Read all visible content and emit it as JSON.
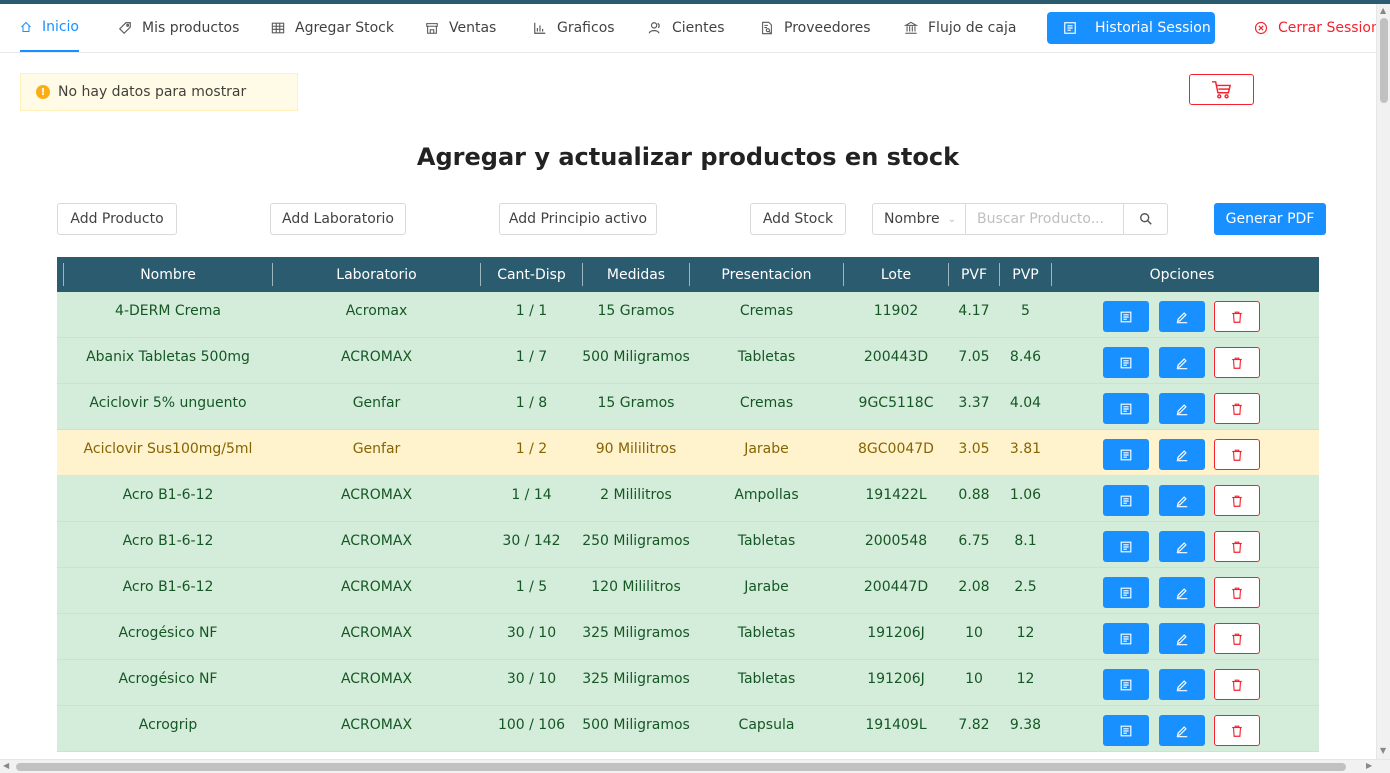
{
  "nav": {
    "items": [
      {
        "label": "Inicio",
        "icon": "home-icon",
        "active": true
      },
      {
        "label": "Mis productos",
        "icon": "tag-icon"
      },
      {
        "label": "Agregar Stock",
        "icon": "table-icon"
      },
      {
        "label": "Ventas",
        "icon": "shop-icon"
      },
      {
        "label": "Graficos",
        "icon": "bar-chart-icon"
      },
      {
        "label": "Cientes",
        "icon": "team-icon"
      },
      {
        "label": "Proveedores",
        "icon": "file-search-icon"
      },
      {
        "label": "Flujo de caja",
        "icon": "bank-icon"
      }
    ],
    "history_label": "Historial Session",
    "logout_label": "Cerrar Session"
  },
  "alert": {
    "message": "No hay datos para mostrar"
  },
  "page_title": "Agregar y actualizar productos en stock",
  "toolbar": {
    "add_product": "Add Producto",
    "add_lab": "Add Laboratorio",
    "add_principle": "Add Principio activo",
    "add_stock": "Add Stock",
    "search_field": "Nombre",
    "search_placeholder": "Buscar Producto...",
    "generate_pdf": "Generar PDF"
  },
  "colors": {
    "primary": "#1890ff",
    "danger": "#f5222d",
    "header": "#2b5b6e",
    "row_ok": "#d4edda",
    "row_warn": "#fff3cd"
  },
  "table": {
    "headers": [
      "Nombre",
      "Laboratorio",
      "Cant-Disp",
      "Medidas",
      "Presentacion",
      "Lote",
      "PVF",
      "PVP",
      "Opciones"
    ],
    "rows": [
      {
        "status": "ok",
        "cells": [
          "4-DERM Crema",
          "Acromax",
          "1 / 1",
          "15 Gramos",
          "Cremas",
          "11902",
          "4.17",
          "5"
        ]
      },
      {
        "status": "ok",
        "cells": [
          "Abanix Tabletas 500mg",
          "ACROMAX",
          "1 / 7",
          "500 Miligramos",
          "Tabletas",
          "200443D",
          "7.05",
          "8.46"
        ]
      },
      {
        "status": "ok",
        "cells": [
          "Aciclovir 5% unguento",
          "Genfar",
          "1 / 8",
          "15 Gramos",
          "Cremas",
          "9GC5118C",
          "3.37",
          "4.04"
        ]
      },
      {
        "status": "warn",
        "cells": [
          "Aciclovir Sus100mg/5ml",
          "Genfar",
          "1 / 2",
          "90 Mililitros",
          "Jarabe",
          "8GC0047D",
          "3.05",
          "3.81"
        ]
      },
      {
        "status": "ok",
        "cells": [
          "Acro B1-6-12",
          "ACROMAX",
          "1 / 14",
          "2 Mililitros",
          "Ampollas",
          "191422L",
          "0.88",
          "1.06"
        ]
      },
      {
        "status": "ok",
        "cells": [
          "Acro B1-6-12",
          "ACROMAX",
          "30 / 142",
          "250 Miligramos",
          "Tabletas",
          "2000548",
          "6.75",
          "8.1"
        ]
      },
      {
        "status": "ok",
        "cells": [
          "Acro B1-6-12",
          "ACROMAX",
          "1 / 5",
          "120 Mililitros",
          "Jarabe",
          "200447D",
          "2.08",
          "2.5"
        ]
      },
      {
        "status": "ok",
        "cells": [
          "Acrogésico NF",
          "ACROMAX",
          "30 / 10",
          "325 Miligramos",
          "Tabletas",
          "191206J",
          "10",
          "12"
        ]
      },
      {
        "status": "ok",
        "cells": [
          "Acrogésico NF",
          "ACROMAX",
          "30 / 10",
          "325 Miligramos",
          "Tabletas",
          "191206J",
          "10",
          "12"
        ]
      },
      {
        "status": "ok",
        "cells": [
          "Acrogrip",
          "ACROMAX",
          "100 / 106",
          "500 Miligramos",
          "Capsula",
          "191409L",
          "7.82",
          "9.38"
        ]
      }
    ]
  }
}
